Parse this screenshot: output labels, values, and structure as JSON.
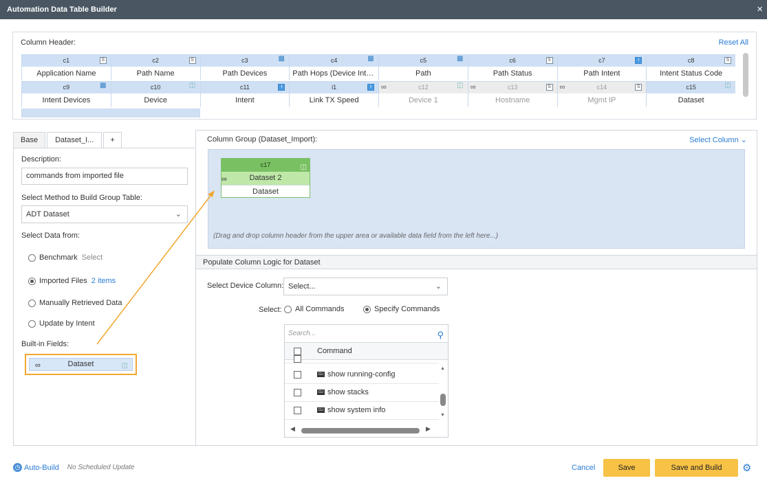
{
  "window": {
    "title": "Automation Data Table Builder",
    "close_icon": "×"
  },
  "column_header": {
    "label": "Column Header:",
    "reset_label": "Reset All",
    "row1": [
      {
        "id": "c1",
        "name": "Application Name",
        "icon": "S"
      },
      {
        "id": "c2",
        "name": "Path Name",
        "icon": "S"
      },
      {
        "id": "c3",
        "name": "Path Devices",
        "icon": "img"
      },
      {
        "id": "c4",
        "name": "Path Hops (Device Inter...",
        "icon": "img"
      },
      {
        "id": "c5",
        "name": "Path",
        "icon": "img"
      },
      {
        "id": "c6",
        "name": "Path Status",
        "icon": "S"
      },
      {
        "id": "c7",
        "name": "Path Intent",
        "icon": "I"
      },
      {
        "id": "c8",
        "name": "Intent Status Code",
        "icon": "S"
      }
    ],
    "row2": [
      {
        "id": "c9",
        "name": "Intent Devices",
        "icon": "img"
      },
      {
        "id": "c10",
        "name": "Device",
        "icon": "db"
      },
      {
        "id": "c11",
        "name": "Intent",
        "icon": "I"
      },
      {
        "id": "i1",
        "name": "Link TX Speed",
        "icon": "I"
      },
      {
        "id": "c12",
        "name": "Device 1",
        "icon": "db"
      },
      {
        "id": "c13",
        "name": "Hostname",
        "icon": "S"
      },
      {
        "id": "c14",
        "name": "Mgmt IP",
        "icon": "S"
      },
      {
        "id": "c15",
        "name": "Dataset",
        "icon": "db"
      }
    ]
  },
  "tabs": [
    "Base",
    "Dataset_I...",
    "+"
  ],
  "left": {
    "description_label": "Description:",
    "description_value": "commands from imported file",
    "method_label": "Select Method to Build Group Table:",
    "method_value": "ADT Dataset",
    "select_data_label": "Select Data from:",
    "radios": [
      {
        "label": "Benchmark",
        "link": "Select"
      },
      {
        "label": "Imported Files",
        "link": "2 items"
      },
      {
        "label": "Manually Retrieved Data",
        "link": ""
      },
      {
        "label": "Update by Intent",
        "link": ""
      }
    ],
    "builtin_label": "Built-in Fields:",
    "builtin_field": "Dataset"
  },
  "right": {
    "column_group_label": "Column Group (Dataset_Import):",
    "select_column_label": "Select Column",
    "card": {
      "id": "c17",
      "name": "Dataset 2",
      "sub": "Dataset"
    },
    "drop_hint": "(Drag and drop column header from the upper area or available data field from the left here...)",
    "populate_label": "Populate Column Logic for Dataset",
    "device_col_label": "Select Device Column:",
    "device_col_value": "Select...",
    "select_label": "Select:",
    "opt_all": "All Commands",
    "opt_specify": "Specify Commands",
    "search_placeholder": "Search...",
    "command_header": "Command",
    "commands": [
      "show running-config",
      "show stacks",
      "show system info"
    ]
  },
  "footer": {
    "auto_build": "Auto-Build",
    "no_schedule": "No Scheduled Update",
    "cancel": "Cancel",
    "save": "Save",
    "save_build": "Save and Build"
  }
}
